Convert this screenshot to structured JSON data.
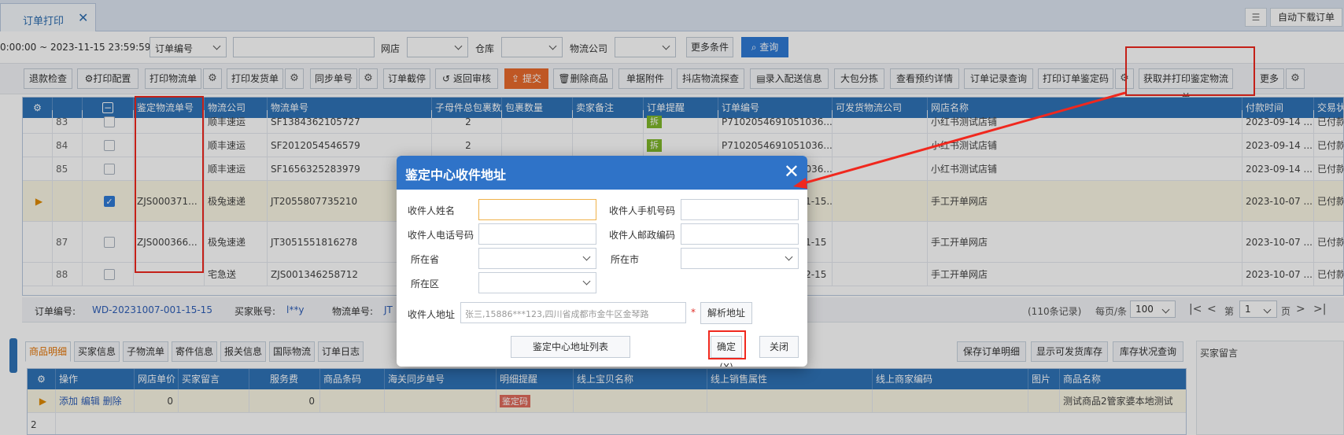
{
  "tab": {
    "title": "订单打印"
  },
  "topright": {
    "auto_download": "自动下载订单"
  },
  "filters": {
    "date_range": "0:00:00 ~ 2023-11-15 23:59:59",
    "order_field": "订单编号",
    "shop_label": "网店",
    "warehouse_label": "仓库",
    "logistics_label": "物流公司",
    "more_conditions": "更多条件",
    "search": "查询"
  },
  "toolbar": {
    "refund_check": "退款检查",
    "print_config": "打印配置",
    "print_logistics": "打印物流单",
    "print_delivery": "打印发货单",
    "sync_number": "同步单号",
    "order_intercept": "订单截停",
    "return_review": "返回审核",
    "submit": "提交",
    "delete_goods": "删除商品",
    "doc_attachment": "单据附件",
    "douyin_probe": "抖店物流探查",
    "enter_delivery": "录入配送信息",
    "big_package": "大包分拣",
    "view_appointment": "查看预约详情",
    "order_record": "订单记录查询",
    "print_appraisal_code": "打印订单鉴定码",
    "get_print_appraisal": "获取并打印鉴定物流单",
    "more": "更多"
  },
  "grid": {
    "columns": [
      "鉴定物流单号",
      "物流公司",
      "物流单号",
      "子母件总包裹数",
      "包裹数量",
      "卖家备注",
      "订单提醒",
      "订单编号",
      "可发货物流公司",
      "网店名称",
      "付款时间",
      "交易状态"
    ],
    "rows": [
      {
        "no": "83",
        "appraisal": "",
        "company": "顺丰速运",
        "tracking": "SF1384362105727",
        "pkg": "2",
        "badge": "拆",
        "order": "P7102054691051036...",
        "shop": "小红书测试店铺",
        "paytime": "2023-09-14 ...",
        "status": "已付款",
        "checked": false,
        "arrow": false
      },
      {
        "no": "84",
        "appraisal": "",
        "company": "顺丰速运",
        "tracking": "SF2012054546579",
        "pkg": "2",
        "badge": "拆",
        "order": "P7102054691051036...",
        "shop": "小红书测试店铺",
        "paytime": "2023-09-14 ...",
        "status": "已付款",
        "checked": false,
        "arrow": false
      },
      {
        "no": "85",
        "appraisal": "",
        "company": "顺丰速运",
        "tracking": "SF1656325283979",
        "pkg": "2",
        "badge": "",
        "order": "P7102054691051036...",
        "shop": "小红书测试店铺",
        "paytime": "2023-09-14 ...",
        "status": "已付款",
        "checked": false,
        "arrow": false
      },
      {
        "no": "",
        "appraisal": "ZJS000371...",
        "company": "极兔速递",
        "tracking": "JT2055807735210",
        "pkg": "",
        "badge": "",
        "order": "WD-20231007-001-15...",
        "shop": "手工开单网店",
        "paytime": "2023-10-07 ...",
        "status": "已付款",
        "checked": true,
        "arrow": true
      },
      {
        "no": "87",
        "appraisal": "ZJS000366...",
        "company": "极兔速递",
        "tracking": "JT3051551816278",
        "pkg": "",
        "badge": "",
        "order": "WD-20231007-001-15",
        "shop": "手工开单网店",
        "paytime": "2023-10-07 ...",
        "status": "已付款",
        "checked": false,
        "arrow": false
      },
      {
        "no": "88",
        "appraisal": "",
        "company": "宅急送",
        "tracking": "ZJS001346258712",
        "pkg": "",
        "badge": "",
        "order": "WD-20231007-002-15",
        "shop": "手工开单网店",
        "paytime": "2023-10-07 ...",
        "status": "已付款",
        "checked": false,
        "arrow": false
      }
    ]
  },
  "statusbar": {
    "order_label": "订单编号:",
    "order_value": "WD-20231007-001-15-15",
    "buyer_label": "买家账号:",
    "buyer_value": "l**y",
    "tracking_label": "物流单号:",
    "tracking_value": "JT",
    "records": "(110条记录)",
    "per_page_label": "每页/条",
    "per_page": "100",
    "page_prefix": "第",
    "page": "1",
    "page_suffix": "页"
  },
  "bottom_tabs": [
    "商品明细",
    "买家信息",
    "子物流单",
    "寄件信息",
    "报关信息",
    "国际物流",
    "订单日志"
  ],
  "bottom_actions": {
    "save_detail": "保存订单明细",
    "show_stock": "显示可发货库存",
    "stock_query": "库存状况查询",
    "buyer_message": "买家留言"
  },
  "bottom_grid": {
    "columns": [
      "操作",
      "网店单价",
      "买家留言",
      "服务费",
      "商品条码",
      "海关同步单号",
      "明细提醒",
      "线上宝贝名称",
      "线上销售属性",
      "线上商家编码",
      "图片",
      "商品名称"
    ],
    "row1": {
      "ops": "添加 编辑 删除",
      "price": "0",
      "fee": "0",
      "tag": "鉴定码",
      "goods": "测试商品2管家婆本地测试"
    },
    "row2_no": "2"
  },
  "dialog": {
    "title": "鉴定中心收件地址",
    "recipient_name": "收件人姓名",
    "recipient_mobile": "收件人手机号码",
    "recipient_phone": "收件人电话号码",
    "recipient_zip": "收件人邮政编码",
    "province": "所在省",
    "city": "所在市",
    "district": "所在区",
    "address_label": "收件人地址",
    "address_placeholder": "张三,15886***123,四川省成都市金牛区金琴路",
    "parse_address": "解析地址",
    "address_list": "鉴定中心地址列表",
    "confirm": "确定(X)",
    "close": "关闭"
  }
}
